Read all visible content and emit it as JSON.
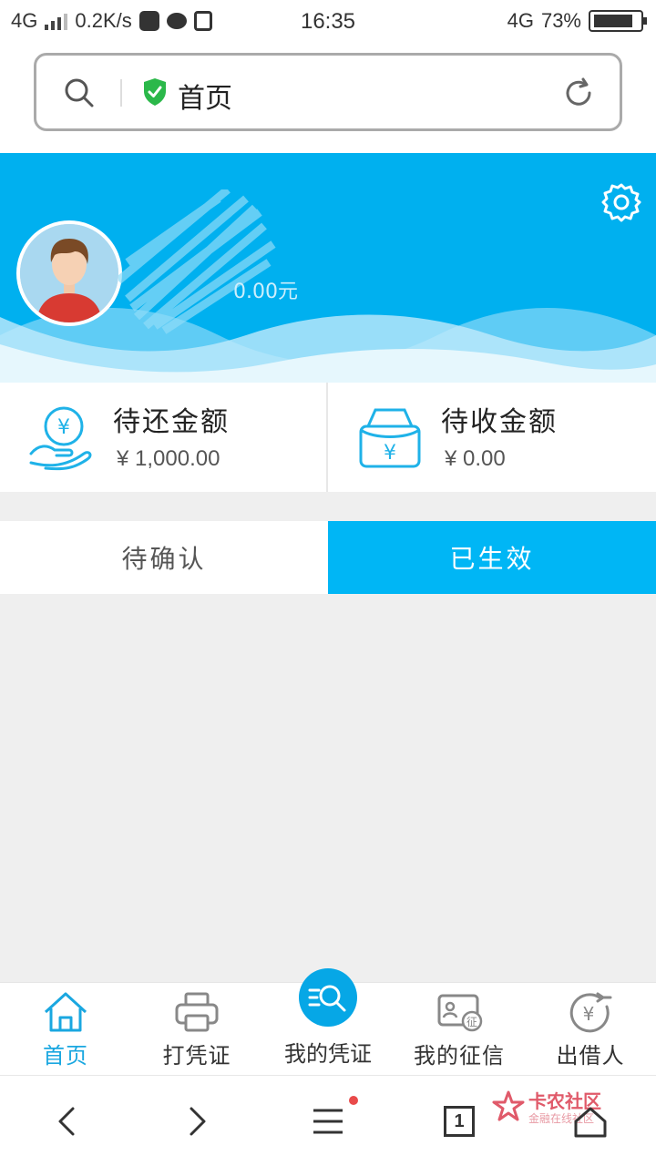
{
  "status": {
    "network": "4G",
    "speed": "0.2K/s",
    "time": "16:35",
    "network_right": "4G",
    "battery": "73%"
  },
  "urlbar": {
    "title": "首页"
  },
  "profile": {
    "balance_text": "0.00元"
  },
  "amounts": [
    {
      "label": "待还金额",
      "value": "¥ 1,000.00"
    },
    {
      "label": "待收金额",
      "value": "¥ 0.00"
    }
  ],
  "tabs": [
    {
      "label": "待确认",
      "active": false
    },
    {
      "label": "已生效",
      "active": true
    }
  ],
  "bottom_nav": [
    {
      "label": "首页",
      "icon": "home-icon",
      "active": true
    },
    {
      "label": "打凭证",
      "icon": "printer-icon",
      "active": false
    },
    {
      "label": "我的凭证",
      "icon": "search-list-icon",
      "active": false
    },
    {
      "label": "我的征信",
      "icon": "credit-card-icon",
      "active": false
    },
    {
      "label": "出借人",
      "icon": "yen-coin-icon",
      "active": false
    }
  ],
  "browser": {
    "tab_count": "1"
  },
  "watermark": {
    "title": "卡农社区",
    "subtitle": "金融在线社区"
  },
  "colors": {
    "accent": "#00b0ef",
    "active_tab": "#00b6f5",
    "nav_active": "#1aa7e0"
  }
}
